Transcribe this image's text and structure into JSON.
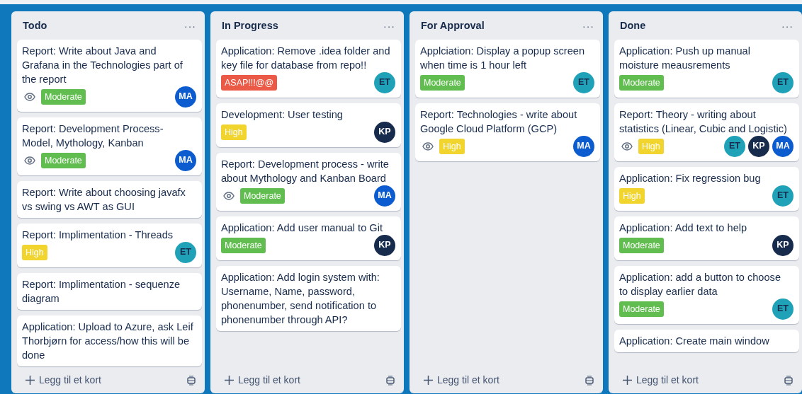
{
  "lists": [
    {
      "title": "Todo",
      "menu": "···",
      "add_card": "Legg til et kort",
      "cards": [
        {
          "title": "Report: Write about Java and Grafana in the Technologies part of the report",
          "watching": true,
          "labels": [
            {
              "text": "Moderate",
              "color": "#61bd4f"
            }
          ],
          "members": [
            {
              "initials": "MA",
              "color": "#0c5ccf"
            }
          ]
        },
        {
          "title": "Report: Development Process-Model, Mythology, Kanban",
          "watching": true,
          "labels": [
            {
              "text": "Moderate",
              "color": "#61bd4f"
            }
          ],
          "members": [
            {
              "initials": "MA",
              "color": "#0c5ccf"
            }
          ]
        },
        {
          "title": "Report: Write about choosing javafx vs swing vs AWT as GUI",
          "watching": false
        },
        {
          "title": "Report: Implimentation - Threads",
          "watching": false,
          "labels": [
            {
              "text": "High",
              "color": "#f2d42e"
            }
          ],
          "members": [
            {
              "initials": "ET",
              "color": "#1fa2b8"
            }
          ]
        },
        {
          "title": "Report: Implimentation - sequenze diagram",
          "watching": false
        },
        {
          "title": "Application: Upload to Azure, ask Leif Thorbjørn for access/how this will be done",
          "watching": false
        }
      ]
    },
    {
      "title": "In Progress",
      "menu": "···",
      "add_card": "Legg til et kort",
      "cards": [
        {
          "title": "Application: Remove .idea folder and key file for database from repo!!",
          "watching": false,
          "labels": [
            {
              "text": "ASAP!!!@@",
              "color": "#eb5a46"
            }
          ],
          "members": [
            {
              "initials": "ET",
              "color": "#1fa2b8"
            }
          ]
        },
        {
          "title": "Development: User testing",
          "watching": false,
          "labels": [
            {
              "text": "High",
              "color": "#f2d42e"
            }
          ],
          "members": [
            {
              "initials": "KP",
              "color": "#172b4d"
            }
          ]
        },
        {
          "title": "Report: Development process - write about Mythology and Kanban Board",
          "watching": true,
          "labels": [
            {
              "text": "Moderate",
              "color": "#61bd4f"
            }
          ],
          "members": [
            {
              "initials": "MA",
              "color": "#0c5ccf"
            }
          ]
        },
        {
          "title": "Application: Add user manual to Git",
          "watching": false,
          "labels": [
            {
              "text": "Moderate",
              "color": "#61bd4f"
            }
          ],
          "members": [
            {
              "initials": "KP",
              "color": "#172b4d"
            }
          ]
        },
        {
          "title": "Application: Add login system with: Username, Name, password, phonenumber, send notification to phonenumber through API?",
          "watching": false
        }
      ]
    },
    {
      "title": "For Approval",
      "menu": "···",
      "add_card": "Legg til et kort",
      "cards": [
        {
          "title": "Applciation: Display a popup screen when time is 1 hour left",
          "watching": false,
          "labels": [
            {
              "text": "Moderate",
              "color": "#61bd4f"
            }
          ],
          "members": [
            {
              "initials": "ET",
              "color": "#1fa2b8"
            }
          ]
        },
        {
          "title": "Report: Technologies - write about Google Cloud Platform (GCP)",
          "watching": true,
          "labels": [
            {
              "text": "High",
              "color": "#f2d42e"
            }
          ],
          "members": [
            {
              "initials": "MA",
              "color": "#0c5ccf"
            }
          ]
        }
      ]
    },
    {
      "title": "Done",
      "menu": "···",
      "add_card": "Legg til et kort",
      "cards": [
        {
          "title": "Application: Push up manual moisture meausrements",
          "watching": false,
          "labels": [
            {
              "text": "Moderate",
              "color": "#61bd4f"
            }
          ],
          "members": [
            {
              "initials": "ET",
              "color": "#1fa2b8"
            }
          ]
        },
        {
          "title": "Report: Theory - writing about statistics (Linear, Cubic and Logistic)",
          "watching": true,
          "labels": [
            {
              "text": "High",
              "color": "#f2d42e"
            }
          ],
          "members": [
            {
              "initials": "ET",
              "color": "#1fa2b8"
            },
            {
              "initials": "KP",
              "color": "#172b4d"
            },
            {
              "initials": "MA",
              "color": "#0c5ccf"
            }
          ]
        },
        {
          "title": "Application: Fix regression bug",
          "watching": false,
          "labels": [
            {
              "text": "High",
              "color": "#f2d42e"
            }
          ],
          "members": [
            {
              "initials": "ET",
              "color": "#1fa2b8"
            }
          ]
        },
        {
          "title": "Application: Add text to help",
          "watching": false,
          "labels": [
            {
              "text": "Moderate",
              "color": "#61bd4f"
            }
          ],
          "members": [
            {
              "initials": "KP",
              "color": "#172b4d"
            }
          ]
        },
        {
          "title": "Application: add a button to choose to display earlier data",
          "watching": false,
          "labels": [
            {
              "text": "Moderate",
              "color": "#61bd4f"
            }
          ],
          "members": [
            {
              "initials": "ET",
              "color": "#1fa2b8"
            }
          ]
        },
        {
          "title": "Application: Create main window",
          "watching": false
        }
      ]
    }
  ]
}
